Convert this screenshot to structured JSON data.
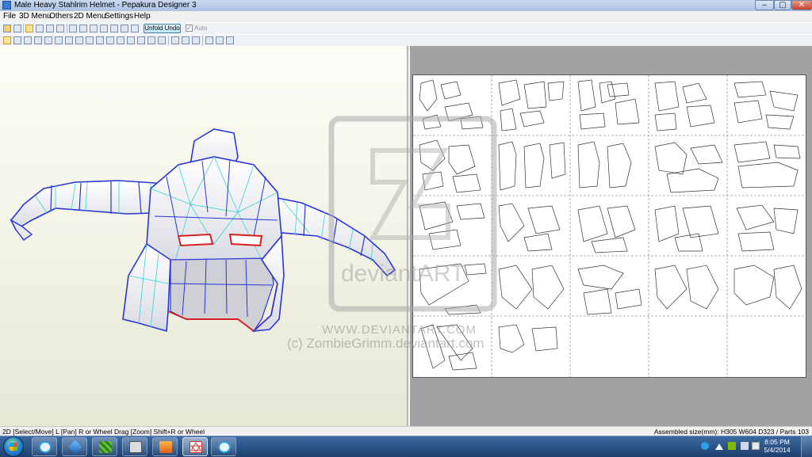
{
  "window": {
    "title": "Male Heavy Stahlrim Helmet - Pepakura Designer 3",
    "minimize_glyph": "‒",
    "maximize_glyph": "▢",
    "close_glyph": "✕"
  },
  "menu": [
    "File",
    "3D Menu",
    "Others",
    "2D Menu",
    "Settings",
    "Help"
  ],
  "toolbar": {
    "unfold_undo_label": "Unfold Undo",
    "auto_label": "Auto",
    "auto_checked": true
  },
  "watermark": {
    "brand": "deviantART",
    "url": "WWW.DEVIANTART.COM",
    "copyright": "(c) ZombieGrimm.deviantart.com"
  },
  "status": {
    "left": "2D [Select/Move] L [Pan] R or Wheel Drag [Zoom] Shift+R or Wheel",
    "right": "Assembled size(mm): H305 W604 D323 / Parts 103"
  },
  "taskbar": {
    "apps": [
      "internet-explorer",
      "3d-modeler",
      "texture-tool",
      "media-app",
      "file-manager",
      "pepakura-designer",
      "internet-explorer"
    ],
    "active_app": "pepakura-designer",
    "clock_time": "8:05 PM",
    "clock_date": "5/4/2014"
  },
  "colors": {
    "mesh_fill": "#ffffff",
    "mesh_edge_blue": "#2b35d6",
    "mesh_edge_cyan": "#35d2d2",
    "mesh_edge_red": "#d92020",
    "view2d_bg": "#a2a2a2"
  }
}
